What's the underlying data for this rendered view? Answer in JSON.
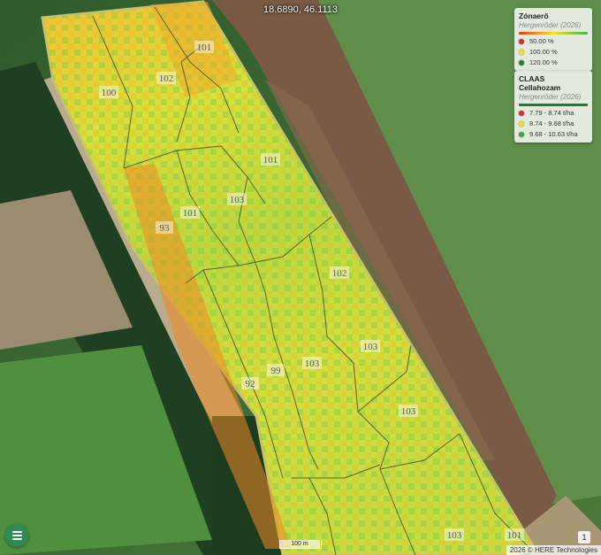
{
  "coordinates": "18.6890, 46.1113",
  "legends": [
    {
      "title": "Zónaerő",
      "subtitle": "Hergenröder (2026)",
      "gradient": [
        "#e23b1b",
        "#f7e02a",
        "#4caf50"
      ],
      "items": [
        {
          "color": "#d32f2f",
          "label": "50.00 %"
        },
        {
          "color": "#f5e31a",
          "label": "100.00 %"
        },
        {
          "color": "#2e7d32",
          "label": "120.00 %"
        }
      ]
    },
    {
      "title": "CLAAS Cellahozam",
      "subtitle": "Hergenröder (2026)",
      "gradient": [
        "#1e7d32",
        "#1e7d32"
      ],
      "items": [
        {
          "color": "#d32f2f",
          "label": "7.79 - 8.74 t/ha"
        },
        {
          "color": "#f5e31a",
          "label": "8.74 - 9.68 t/ha"
        },
        {
          "color": "#43a047",
          "label": "9.68 - 10.63 t/ha"
        }
      ]
    }
  ],
  "zones": [
    "101",
    "102",
    "100",
    "101",
    "103",
    "101",
    "93",
    "102",
    "103",
    "99",
    "103",
    "92",
    "103",
    "103",
    "101"
  ],
  "scale_label": "100 m",
  "count_badge": "1",
  "attribution": "2026 © HERE Technologies",
  "colors": {
    "menu_button": "#2e8b57"
  }
}
